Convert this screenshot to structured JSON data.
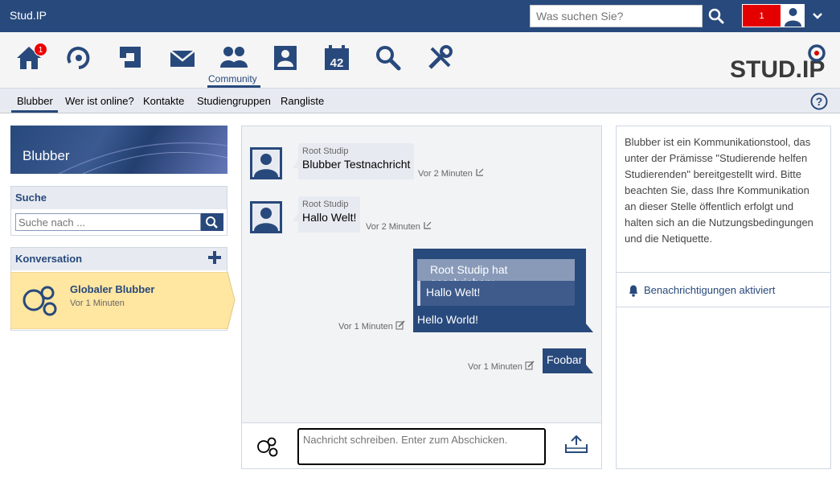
{
  "topbar": {
    "brand": "Stud.IP",
    "search_placeholder": "Was suchen Sie?",
    "notification_count": "1"
  },
  "mainnav": {
    "home_badge": "1",
    "community_label": "Community",
    "calendar_day": "42",
    "logo_text": "STUD.IP"
  },
  "subnav": {
    "items": [
      "Blubber",
      "Wer ist online?",
      "Kontakte",
      "Studiengruppen",
      "Rangliste"
    ]
  },
  "sidebar": {
    "title": "Blubber",
    "search_title": "Suche",
    "search_placeholder": "Suche nach ...",
    "conversation_title": "Konversation",
    "conversation": {
      "name": "Globaler Blubber",
      "time": "Vor 1 Minuten"
    }
  },
  "chat": {
    "messages": [
      {
        "author": "Root Studip",
        "text": "Blubber Testnachricht",
        "time": "Vor 2 Minuten"
      },
      {
        "author": "Root Studip",
        "text": "Hallo Welt!",
        "time": "Vor 2 Minuten"
      }
    ],
    "own_messages": [
      {
        "quote_header": "Root Studip hat geschrieben:",
        "quote_text": "Hallo Welt!",
        "text": "Hello World!",
        "time": "Vor 1 Minuten"
      },
      {
        "text": "Foobar",
        "time": "Vor 1 Minuten"
      }
    ],
    "input_placeholder": "Nachricht schreiben. Enter zum Abschicken."
  },
  "info": {
    "text": "Blubber ist ein Kommunikationstool, das unter der Prämisse \"Studierende helfen Studierenden\" bereitgestellt wird. Bitte beachten Sie, dass Ihre Kommunikation an dieser Stelle öffentlich erfolgt und halten sich an die Nutzungsbedingungen und die Netiquette.",
    "notifications_label": "Benachrichtigungen aktiviert"
  },
  "colors": {
    "primary": "#28497c",
    "highlight": "#ffe6a1",
    "badge": "#e50000"
  }
}
